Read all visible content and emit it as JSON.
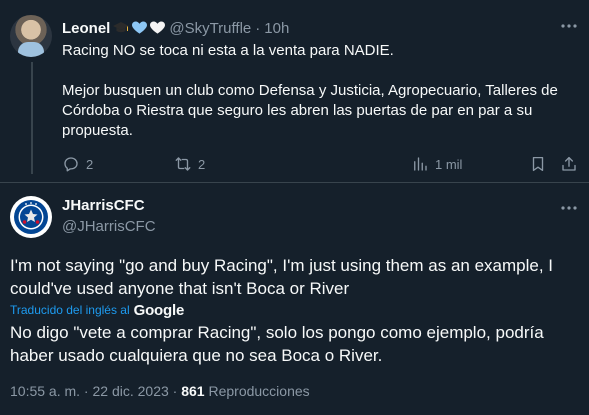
{
  "reply": {
    "author_name": "Leonel",
    "emojis": [
      "graduation-cap",
      "blue-heart",
      "white-heart"
    ],
    "handle": "@SkyTruffle",
    "separator": "·",
    "time": "10h",
    "paragraph1": "Racing NO se toca ni esta a la venta para NADIE.",
    "paragraph2": "Mejor busquen un club como Defensa y Justicia, Agropecuario, Talleres de Córdoba o Riestra que seguro les abren las puertas de par en par a su propuesta.",
    "replies_count": "2",
    "retweets_count": "2",
    "views_count": "1 mil"
  },
  "main": {
    "author_name": "JHarrisCFC",
    "handle": "@JHarrisCFC",
    "text": "I'm not saying \"go and buy Racing\", I'm just using them as an example, I could've used anyone that isn't Boca or River",
    "translated_label": "Traducido del inglés al",
    "translator": "Google",
    "translation": "No digo \"vete a comprar Racing\", solo los pongo como ejemplo, podría haber usado cualquiera que no sea Boca o River.",
    "timestamp": "10:55 a. m. · 22 dic. 2023 ·",
    "views": "861",
    "views_label": "Reproducciones"
  },
  "colors": {
    "background": "#15202b",
    "text": "#f7f9f9",
    "muted": "#8b98a5",
    "accent": "#1d9bf0",
    "divider": "#38444d",
    "chelsea_blue": "#034694"
  }
}
